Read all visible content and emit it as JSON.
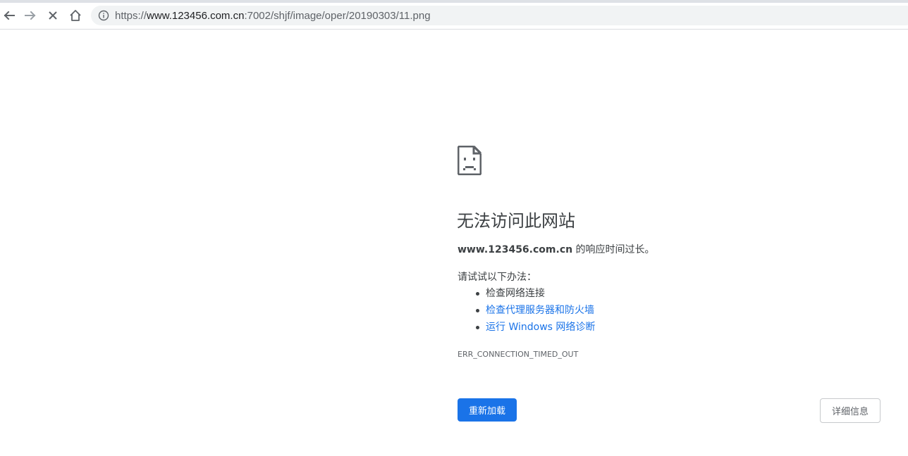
{
  "browser": {
    "url_scheme": "https://",
    "url_host": "www.123456.com.cn",
    "url_rest": ":7002/shjf/image/oper/20190303/11.png",
    "icons": {
      "back": "arrow-left-icon",
      "forward": "arrow-right-icon",
      "stop": "close-icon",
      "home": "home-icon",
      "site_info": "info-icon"
    }
  },
  "error_page": {
    "icon": "sad-document-icon",
    "heading": "无法访问此网站",
    "summary_host": "www.123456.com.cn",
    "summary_text": " 的响应时间过长。",
    "suggestions_label": "请试试以下办法：",
    "suggestions": [
      "检查网络连接",
      "检查代理服务器和防火墙",
      "运行 Windows 网络诊断"
    ],
    "error_code": "ERR_CONNECTION_TIMED_OUT",
    "reload_label": "重新加载",
    "details_label": "详细信息"
  },
  "colors": {
    "accent": "#1a73e8",
    "text": "#3c4043",
    "muted": "#5f6368"
  }
}
